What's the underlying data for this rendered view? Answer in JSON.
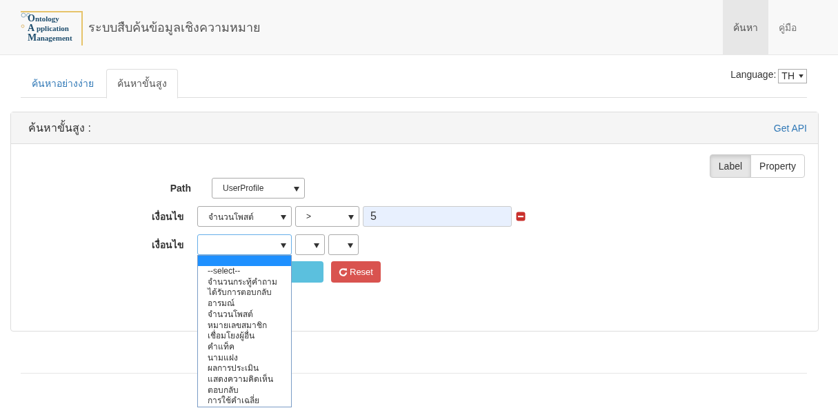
{
  "header": {
    "logo_lines": [
      "Ontology",
      "A pplication",
      "Management"
    ],
    "title": "ระบบสืบค้นข้อมูลเชิงความหมาย",
    "nav": [
      {
        "label": "ค้นหา",
        "selected": true
      },
      {
        "label": "คู่มือ",
        "selected": false
      }
    ]
  },
  "tabs": [
    {
      "label": "ค้นหาอย่างง่าย",
      "selected": false
    },
    {
      "label": "ค้นหาขั้นสูง",
      "selected": true
    }
  ],
  "language": {
    "label": "Language:",
    "value": "TH"
  },
  "panel": {
    "title": "ค้นหาขั้นสูง :",
    "link": "Get API",
    "mode_toggle": [
      {
        "label": "Label",
        "selected": true
      },
      {
        "label": "Property",
        "selected": false
      }
    ],
    "path": {
      "label": "Path",
      "value": "UserProfile"
    },
    "conditions": [
      {
        "label": "เงื่อนไข",
        "field": "จำนวนโพสต์",
        "operator": ">",
        "value": "5",
        "focused": false
      },
      {
        "label": "เงื่อนไข",
        "focused": true
      }
    ],
    "reset_button": "Reset",
    "dropdown": {
      "blank_highlighted": true,
      "options": [
        "--select--",
        "จำนวนกระทู้คำถาม",
        "ได้รับการตอบกลับ",
        "อารมณ์",
        "จำนวนโพสต์",
        "หมายเลขสมาชิก",
        "เชื่อมโยงผู้อื่น",
        "คำแท็ค",
        "นามแฝง",
        "ผลการประเมิน",
        "แสดงความคิดเห็น",
        "ตอบกลับ",
        "การใช้คำเฉลี่ย"
      ]
    }
  }
}
